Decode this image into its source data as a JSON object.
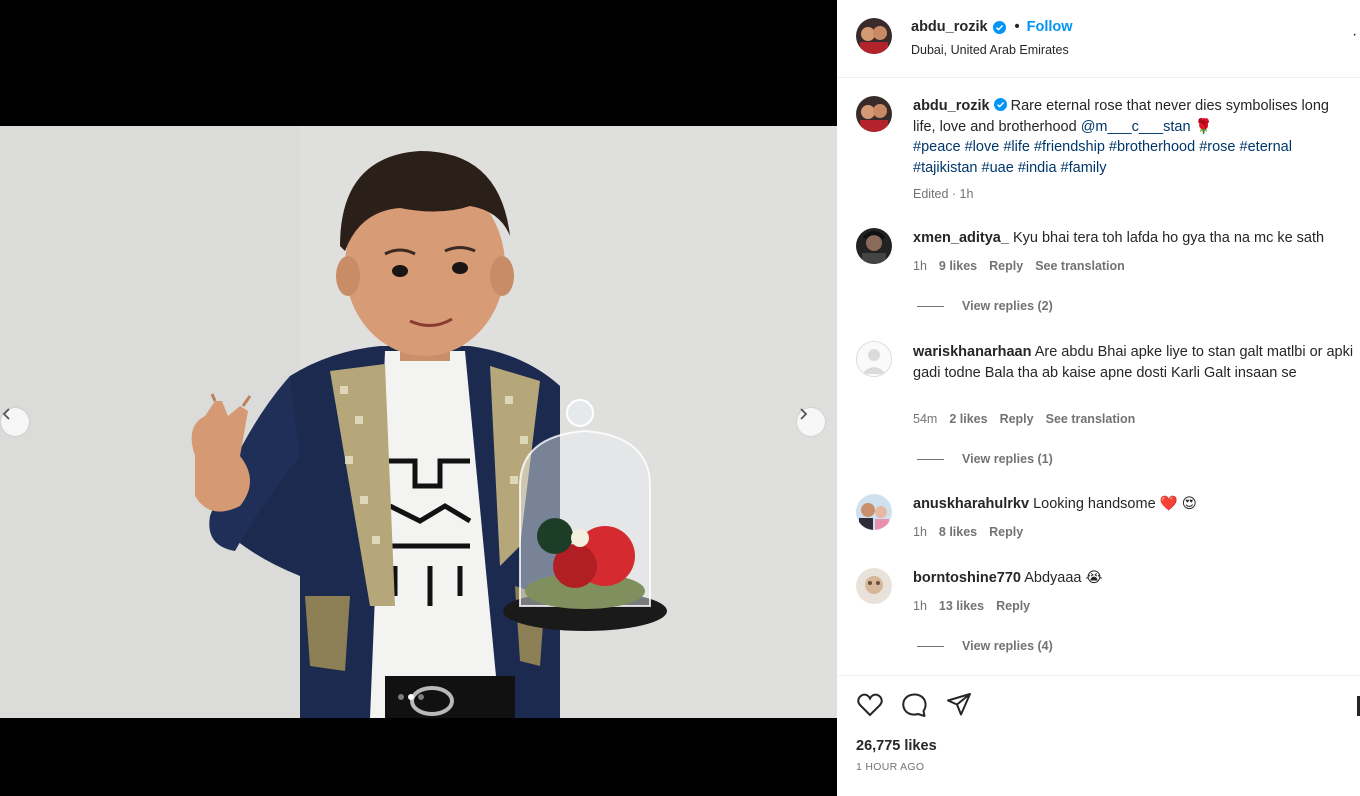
{
  "post": {
    "username": "abdu_rozik",
    "separator": "•",
    "follow_label": "Follow",
    "location": "Dubai, United Arab Emirates",
    "caption_text": "Rare eternal rose that never dies symbolises long life, love and brotherhood",
    "caption_mention": "@m___c___stan",
    "caption_emoji": "🌹",
    "hashtags": [
      "#peace",
      "#love",
      "#life",
      "#friendship",
      "#brotherhood",
      "#rose",
      "#eternal",
      "#tajikistan",
      "#uae",
      "#india",
      "#family"
    ],
    "edited_label": "Edited · 1h",
    "likes_text": "26,775 likes",
    "time_ago": "1 HOUR AGO"
  },
  "carousel": {
    "slide_count": 3,
    "active_index": 1
  },
  "comments": [
    {
      "username": "xmen_aditya_",
      "text": "Kyu bhai tera toh lafda ho gya tha na mc ke sath",
      "time": "1h",
      "likes": "9 likes",
      "reply": "Reply",
      "translate": "See translation",
      "view_replies": "View replies (2)"
    },
    {
      "username": "wariskhanarhaan",
      "text": "Are abdu Bhai apke liye to stan galt matlbi or apki gadi todne Bala tha ab kaise apne dosti Karli Galt insaan se",
      "time": "54m",
      "likes": "2 likes",
      "reply": "Reply",
      "translate": "See translation",
      "view_replies": "View replies (1)"
    },
    {
      "username": "anuskharahulrkv",
      "text": "Looking handsome ❤️ 😍",
      "time": "1h",
      "likes": "8 likes",
      "reply": "Reply"
    },
    {
      "username": "borntoshine770",
      "text": "Abdyaaa 😭",
      "time": "1h",
      "likes": "13 likes",
      "reply": "Reply",
      "view_replies": "View replies (4)"
    }
  ],
  "icons": {
    "like": "heart-icon",
    "comment": "comment-icon",
    "share": "share-icon",
    "verified": "verified-badge-icon",
    "prev": "chevron-left-icon",
    "next": "chevron-right-icon"
  },
  "colors": {
    "accent": "#0095f6",
    "link": "#00376b",
    "muted": "#737373",
    "verified": "#0095f6"
  }
}
